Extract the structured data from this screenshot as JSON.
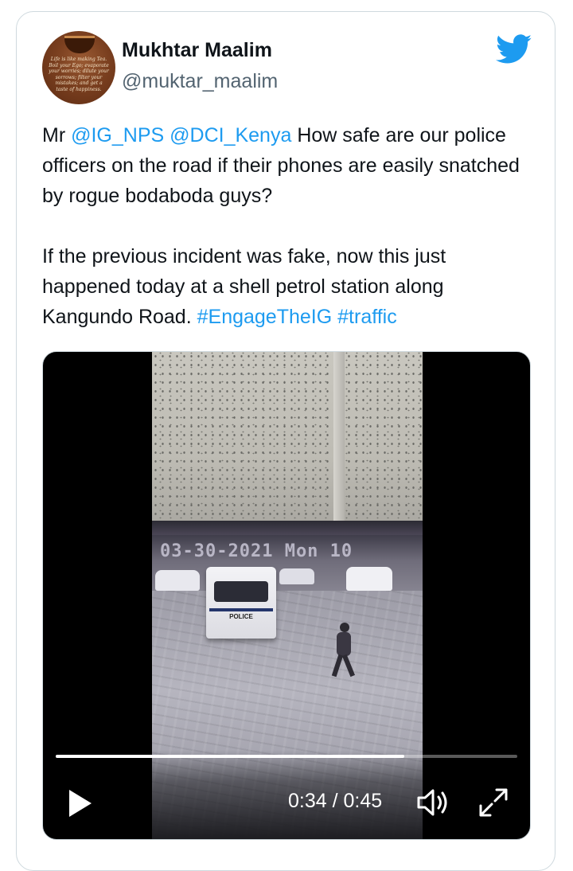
{
  "author": {
    "name": "Mukhtar Maalim",
    "handle": "@muktar_maalim",
    "avatar_text": "Life is like making Tea. Boil your Ego; evaporate your worries; dilute your sorrows; filter your mistakes; and get a taste of happiness."
  },
  "tweet": {
    "p1": {
      "prefix": "Mr ",
      "mention1": "@IG_NPS",
      "space": " ",
      "mention2": "@DCI_Kenya",
      "rest": " How safe are our police officers on the road if their phones are easily snatched by rogue bodaboda guys?"
    },
    "p2": {
      "text": "If the previous incident was fake, now this just happened today at a shell petrol station along Kangundo Road. ",
      "hashtag1": "#EngageTheIG",
      "space": " ",
      "hashtag2": "#traffic"
    }
  },
  "video": {
    "overlay_timestamp": "03-30-2021 Mon 10",
    "vehicle_label": "POLICE",
    "current_time": "0:34",
    "duration": "0:45",
    "time_display": "0:34 / 0:45",
    "progress_fraction": 0.755
  },
  "icons": {
    "brand": "twitter-bird-icon",
    "play": "play-icon",
    "volume": "volume-icon",
    "fullscreen": "fullscreen-icon"
  },
  "colors": {
    "link": "#1d9bf0",
    "text": "#0f1419",
    "secondary": "#536471",
    "border": "#cfd9de"
  }
}
